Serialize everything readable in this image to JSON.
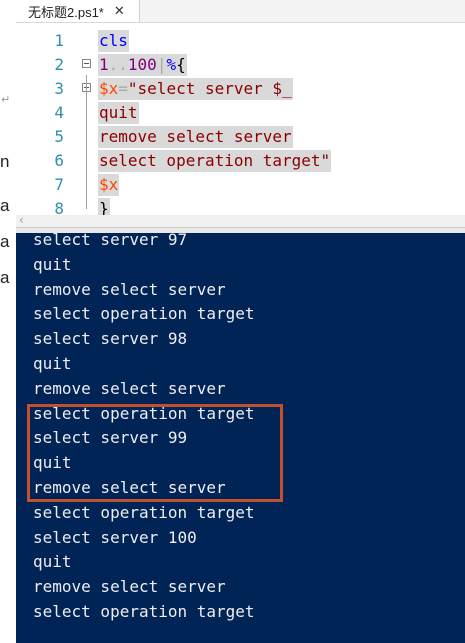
{
  "tab": {
    "title": "无标题2.ps1*",
    "close_glyph": "✕"
  },
  "doc_fragments": [
    "n",
    "a",
    "a",
    "a"
  ],
  "editor": {
    "lines": [
      {
        "num": "1",
        "segments": [
          {
            "text": "cls",
            "cls": "c-kw"
          }
        ]
      },
      {
        "num": "2",
        "segments": [
          {
            "text": "1",
            "cls": "c-num"
          },
          {
            "text": "..",
            "cls": "c-op"
          },
          {
            "text": "100",
            "cls": "c-num"
          },
          {
            "text": "|",
            "cls": "c-op"
          },
          {
            "text": "%",
            "cls": "c-kw"
          },
          {
            "text": "{",
            "cls": "c-brace"
          }
        ]
      },
      {
        "num": "3",
        "segments": [
          {
            "text": "$x",
            "cls": "c-var"
          },
          {
            "text": "=",
            "cls": "c-op"
          },
          {
            "text": "\"select server $_",
            "cls": "c-str"
          }
        ]
      },
      {
        "num": "4",
        "segments": [
          {
            "text": "quit",
            "cls": "c-str"
          }
        ]
      },
      {
        "num": "5",
        "segments": [
          {
            "text": "remove select server",
            "cls": "c-str"
          }
        ]
      },
      {
        "num": "6",
        "segments": [
          {
            "text": "select operation target\"",
            "cls": "c-str"
          }
        ]
      },
      {
        "num": "7",
        "segments": [
          {
            "text": "$x",
            "cls": "c-var"
          }
        ]
      },
      {
        "num": "8",
        "segments": [
          {
            "text": "}",
            "cls": "c-brace"
          }
        ]
      }
    ]
  },
  "console": {
    "lines": [
      "select server 97",
      "quit",
      "remove select server",
      "select operation target",
      "select server 98",
      "quit",
      "remove select server",
      "select operation target",
      "select server 99",
      "quit",
      "remove select server",
      "select operation target",
      "select server 100",
      "quit",
      "remove select server",
      "select operation target"
    ]
  },
  "colors": {
    "console_bg": "#012456",
    "highlight_border": "#c0502e"
  }
}
